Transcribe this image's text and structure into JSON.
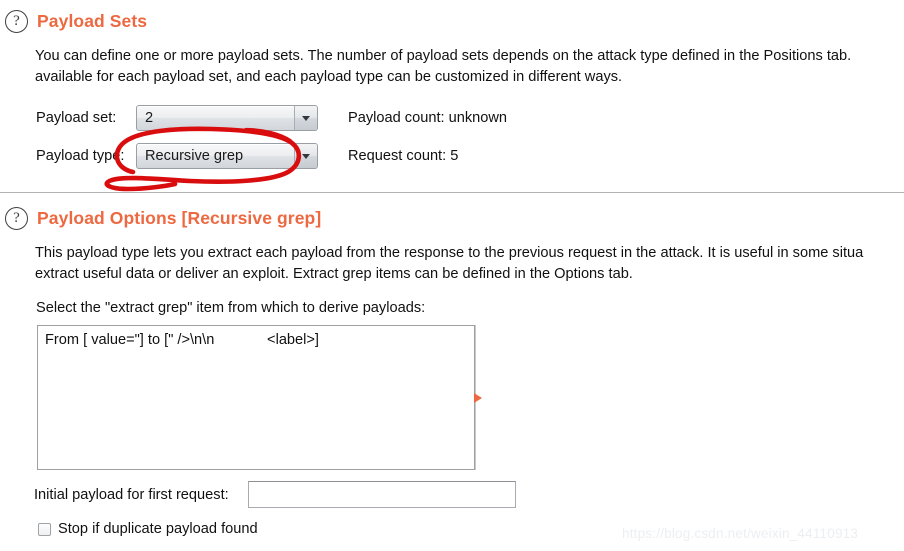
{
  "sections": {
    "payload_sets": {
      "help_icon": "question-mark-icon",
      "title": "Payload Sets",
      "description_line1": "You can define one or more payload sets. The number of payload sets depends on the attack type defined in the Positions tab.",
      "description_line2": "available for each payload set, and each payload type can be customized in different ways.",
      "payload_set_label": "Payload set:",
      "payload_set_value": "2",
      "payload_type_label": "Payload type:",
      "payload_type_value": "Recursive grep",
      "payload_count_label": "Payload count:",
      "payload_count_value": "unknown",
      "request_count_label": "Request count:",
      "request_count_value": "5"
    },
    "payload_options": {
      "help_icon": "question-mark-icon",
      "title": "Payload Options [Recursive grep]",
      "description_line1": "This payload type lets you extract each payload from the response to the previous request in the attack. It is useful in some situa",
      "description_line2": "extract useful data or deliver an exploit. Extract grep items can be defined in the Options tab.",
      "select_label": "Select the \"extract grep\" item from which to derive payloads:",
      "grep_items": [
        "From [ value=\"] to [\" />\\n\\n             <label>]"
      ],
      "splitter_icon": "expand-right-arrow-icon",
      "initial_payload_label": "Initial payload for first request:",
      "initial_payload_value": "",
      "initial_payload_placeholder": "",
      "stop_duplicate_label": "Stop if duplicate payload found",
      "stop_duplicate_checked": false
    }
  },
  "annotation": {
    "shape": "hand-drawn-red-ellipse",
    "color": "#d90d0d",
    "target": "payload-type-combo"
  },
  "watermark": {
    "text": "https://blog.csdn.net/weixin_44110913"
  },
  "colors": {
    "accent_orange": "#ec6941",
    "annotation_red": "#d90d0d",
    "divider": "#b2b2b2",
    "text": "#111111"
  }
}
